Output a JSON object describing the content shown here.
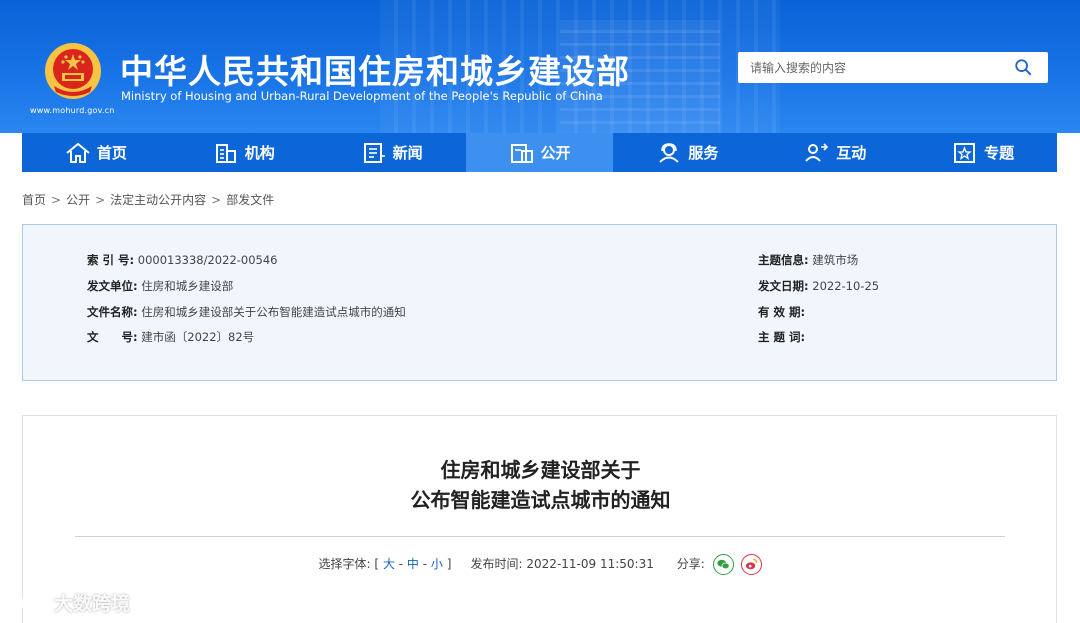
{
  "header": {
    "site_url": "www.mohurd.gov.cn",
    "title_cn": "中华人民共和国住房和城乡建设部",
    "title_en": "Ministry of Housing and Urban-Rural Development of the People's Republic of China",
    "search_placeholder": "请输入搜索的内容"
  },
  "nav": {
    "items": [
      {
        "label": "首页",
        "icon": "home-icon"
      },
      {
        "label": "机构",
        "icon": "building-icon"
      },
      {
        "label": "新闻",
        "icon": "news-icon"
      },
      {
        "label": "公开",
        "icon": "document-icon",
        "active": true
      },
      {
        "label": "服务",
        "icon": "service-icon"
      },
      {
        "label": "互动",
        "icon": "interaction-icon"
      },
      {
        "label": "专题",
        "icon": "topic-icon"
      }
    ]
  },
  "breadcrumb": [
    "首页",
    "公开",
    "法定主动公开内容",
    "部发文件"
  ],
  "meta": {
    "index_label": "索 引 号:",
    "index_value": "000013338/2022-00546",
    "issuer_label": "发文单位:",
    "issuer_value": "住房和城乡建设部",
    "docname_label": "文件名称:",
    "docname_value": "住房和城乡建设部关于公布智能建造试点城市的通知",
    "docno_label": "文　　号:",
    "docno_value": "建市函〔2022〕82号",
    "topic_label": "主题信息:",
    "topic_value": "建筑市场",
    "date_label": "发文日期:",
    "date_value": "2022-10-25",
    "valid_label": "有 效 期:",
    "valid_value": "",
    "keywords_label": "主 题 词:",
    "keywords_value": ""
  },
  "article": {
    "title_line1": "住房和城乡建设部关于",
    "title_line2": "公布智能建造试点城市的通知",
    "font_label": "选择字体:",
    "font_open": "[",
    "font_large": "大",
    "font_medium": "中",
    "font_small": "小",
    "font_close": "]",
    "publish_label": "发布时间:",
    "publish_time": "2022-11-09 11:50:31",
    "share_label": "分享:"
  },
  "watermark": "大数跨境",
  "colors": {
    "header_blue": "#0a63d8",
    "nav_active": "#3d8ff0",
    "meta_bg": "#f1f6fc",
    "link_blue": "#1565c0"
  }
}
